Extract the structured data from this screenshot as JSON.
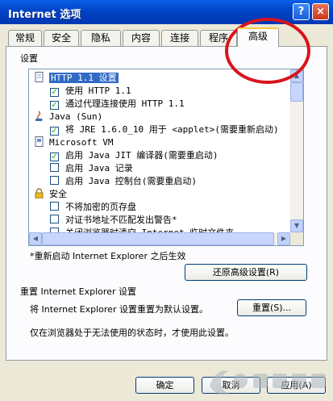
{
  "window": {
    "title": "Internet 选项",
    "help_glyph": "?",
    "close_glyph": "×"
  },
  "tabs": [
    {
      "label": "常规"
    },
    {
      "label": "安全"
    },
    {
      "label": "隐私"
    },
    {
      "label": "内容"
    },
    {
      "label": "连接"
    },
    {
      "label": "程序"
    },
    {
      "label": "高级",
      "active": true
    }
  ],
  "settings": {
    "group_label": "设置",
    "rows": [
      {
        "type": "category",
        "icon": "page-icon",
        "label": "HTTP 1.1 设置",
        "selected": true
      },
      {
        "type": "checkbox",
        "checked": true,
        "label": "使用 HTTP 1.1"
      },
      {
        "type": "checkbox",
        "checked": true,
        "label": "通过代理连接使用 HTTP 1.1"
      },
      {
        "type": "category",
        "icon": "java-icon",
        "label": "Java (Sun)"
      },
      {
        "type": "checkbox",
        "checked": true,
        "label": "将 JRE 1.6.0_10 用于 <applet>(需要重新启动)"
      },
      {
        "type": "category",
        "icon": "vm-icon",
        "label": "Microsoft VM"
      },
      {
        "type": "checkbox",
        "checked": true,
        "label": "启用 Java JIT 编译器(需要重启动)"
      },
      {
        "type": "checkbox",
        "checked": false,
        "label": "启用 Java 记录"
      },
      {
        "type": "checkbox",
        "checked": false,
        "label": "启用 Java 控制台(需要重启动)"
      },
      {
        "type": "category",
        "icon": "lock-icon",
        "label": "安全"
      },
      {
        "type": "checkbox",
        "checked": false,
        "label": "不将加密的页存盘"
      },
      {
        "type": "checkbox",
        "checked": false,
        "label": "对证书地址不匹配发出警告*"
      },
      {
        "type": "checkbox",
        "checked": false,
        "label": "关闭浏览器时清空 Internet 临时文件夹"
      }
    ],
    "restart_note": "*重新启动 Internet Explorer 之后生效",
    "restore_button": "还原高级设置(R)"
  },
  "reset": {
    "heading": "重置 Internet Explorer 设置",
    "description": "将 Internet Explorer 设置重置为默认设置。",
    "button": "重置(S)...",
    "footnote": "仅在浏览器处于无法使用的状态时，才使用此设置。"
  },
  "footer": {
    "ok": "确定",
    "cancel": "取消",
    "apply": "应用(A)"
  },
  "colors": {
    "titlebar": "#0a5fe6",
    "selection": "#316ac5",
    "annotation_circle": "#d9141b",
    "check_mark": "#21a121"
  }
}
